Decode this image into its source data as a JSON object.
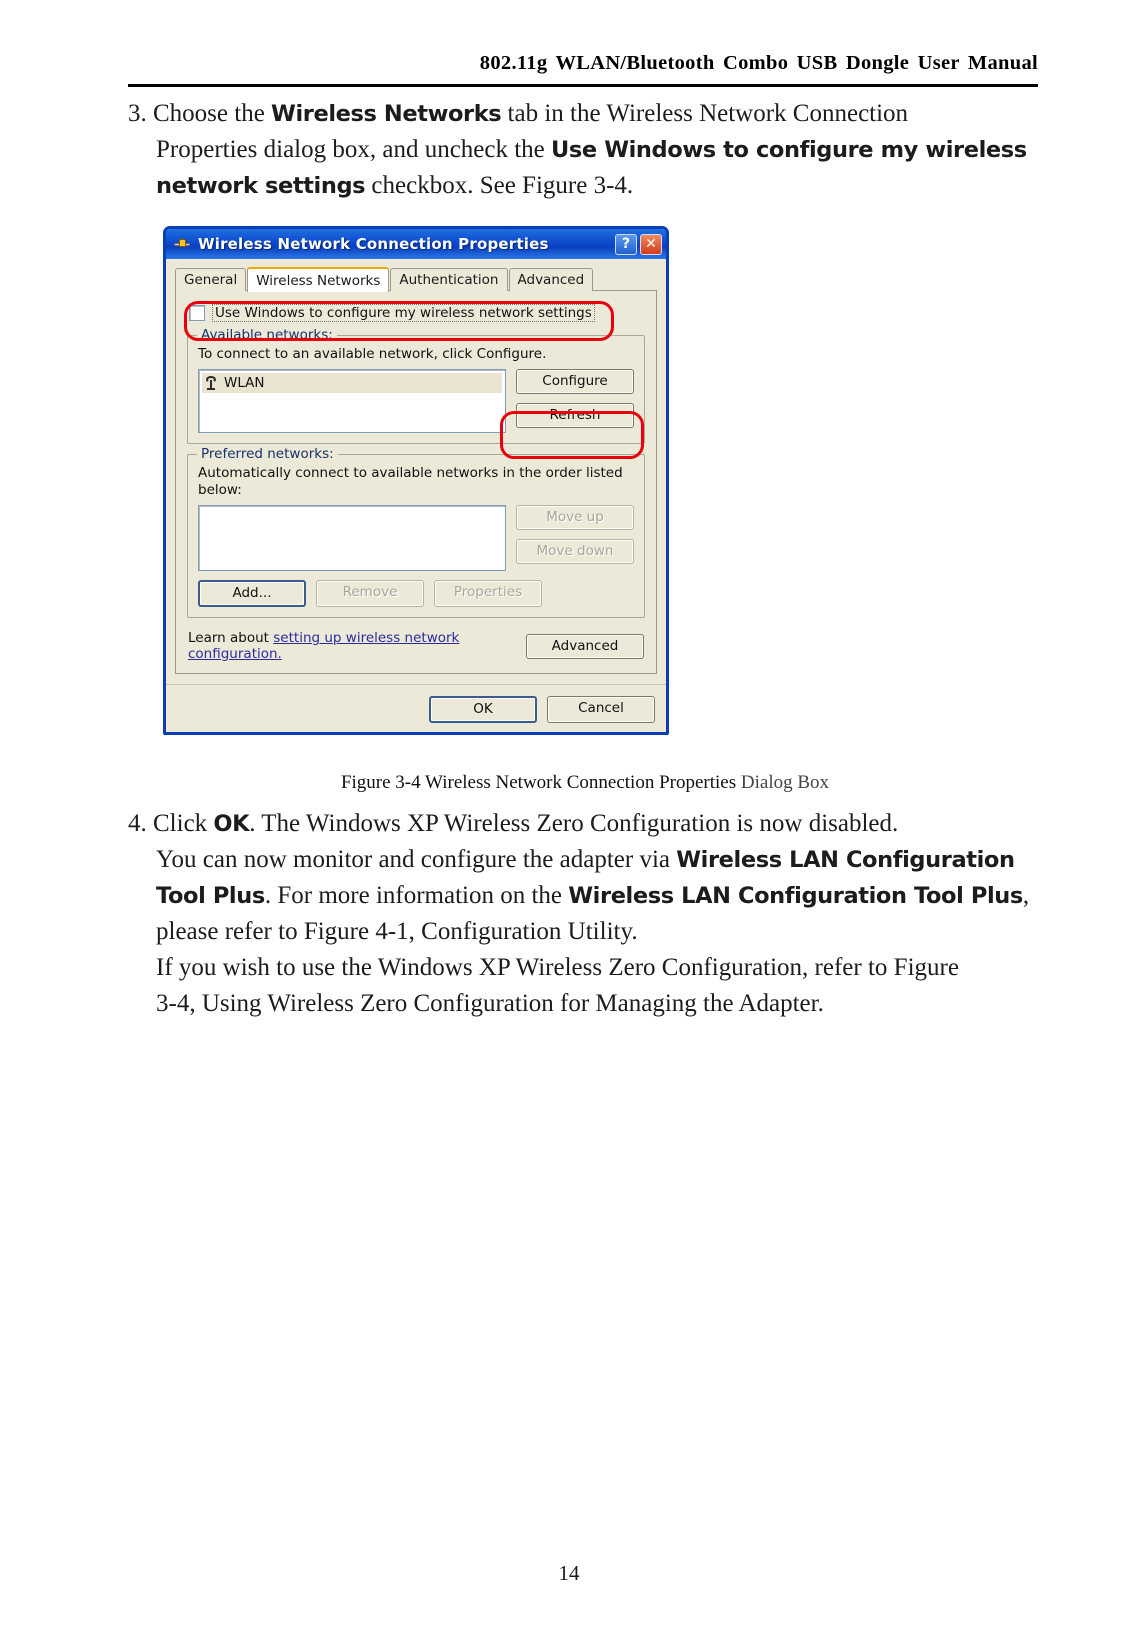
{
  "header": {
    "running_title": "802.11g WLAN/Bluetooth Combo USB Dongle User Manual"
  },
  "step3": {
    "line1_a": "3. Choose the ",
    "line1_b": "Wireless Networks",
    "line1_c": " tab in the Wireless Network Connection",
    "line2_a": "Properties dialog box, and uncheck the ",
    "line2_b": "Use Windows to configure my wireless",
    "line3_a": "network settings",
    "line3_b": " checkbox. See Figure 3-4."
  },
  "dialog": {
    "title": "Wireless Network Connection Properties",
    "title_icon": "network-adapter-icon",
    "help_button": "?",
    "close_button": "✕",
    "tabs": [
      {
        "label": "General",
        "active": false
      },
      {
        "label": "Wireless Networks",
        "active": true
      },
      {
        "label": "Authentication",
        "active": false
      },
      {
        "label": "Advanced",
        "active": false
      }
    ],
    "use_windows_checkbox": {
      "label": "Use Windows to configure my wireless network settings",
      "checked": false
    },
    "available_networks": {
      "legend": "Available networks:",
      "description": "To connect to an available network, click Configure.",
      "items": [
        "WLAN"
      ],
      "buttons": [
        {
          "label": "Configure",
          "disabled": false
        },
        {
          "label": "Refresh",
          "disabled": false
        }
      ]
    },
    "preferred_networks": {
      "legend": "Preferred networks:",
      "description": "Automatically connect to available networks in the order listed below:",
      "items": [],
      "side_buttons": [
        {
          "label": "Move up",
          "disabled": true
        },
        {
          "label": "Move down",
          "disabled": true
        }
      ],
      "bottom_buttons": [
        {
          "label": "Add...",
          "disabled": false
        },
        {
          "label": "Remove",
          "disabled": true
        },
        {
          "label": "Properties",
          "disabled": true
        }
      ]
    },
    "learn": {
      "prefix": "Learn about ",
      "link": "setting up wireless network configuration.",
      "advanced_button": "Advanced"
    },
    "footer_buttons": [
      {
        "label": "OK",
        "default": true
      },
      {
        "label": "Cancel",
        "default": false
      }
    ]
  },
  "caption": {
    "prefix": "Figure 3-4 ",
    "bold": "Wireless Network Connection Properties",
    "suffix": " Dialog Box"
  },
  "step4": {
    "line1_a": "4. Click ",
    "line1_b": "OK",
    "line1_c": ". The Windows XP Wireless Zero Configuration is now disabled.",
    "line2_a": "You can now monitor and configure the adapter via ",
    "line2_b": "Wireless LAN Configuration",
    "line3_a": "Tool Plus",
    "line3_b": ". For more information on the ",
    "line3_c": "Wireless LAN Configuration Tool Plus",
    "line3_d": ",",
    "line4": "please refer to Figure 4-1, Configuration Utility.",
    "line5": "If you wish to use the Windows XP Wireless Zero Configuration, refer to Figure",
    "line6": "3-4, Using Wireless Zero Configuration for Managing the Adapter."
  },
  "footer": {
    "page_number": "14"
  },
  "colors": {
    "annotation_red": "#e8000d",
    "titlebar_blue": "#0a3fb5",
    "dialog_face": "#ece9d8",
    "link_blue": "#2b2b9e"
  }
}
